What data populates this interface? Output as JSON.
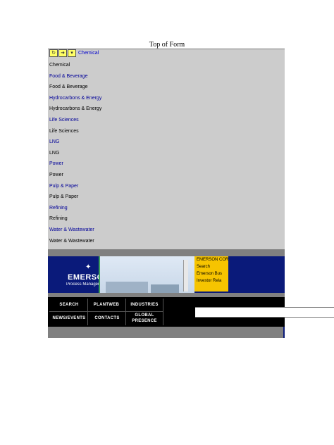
{
  "form": {
    "top_label": "Top of Form"
  },
  "industry_selector": {
    "icons": [
      "refresh-icon",
      "go-icon",
      "dropdown-icon"
    ],
    "selected": "Chemical"
  },
  "industry_list": [
    {
      "label": "Chemical",
      "kind": "text"
    },
    {
      "label": "Food & Beverage",
      "kind": "link"
    },
    {
      "label": "Food & Beverage",
      "kind": "text"
    },
    {
      "label": "Hydrocarbons & Energy",
      "kind": "link"
    },
    {
      "label": "Hydrocarbons & Energy",
      "kind": "text"
    },
    {
      "label": "Life Sciences",
      "kind": "link"
    },
    {
      "label": "Life Sciences",
      "kind": "text"
    },
    {
      "label": "LNG",
      "kind": "link"
    },
    {
      "label": "LNG",
      "kind": "text"
    },
    {
      "label": "Power",
      "kind": "link"
    },
    {
      "label": "Power",
      "kind": "text"
    },
    {
      "label": "Pulp & Paper",
      "kind": "link"
    },
    {
      "label": "Pulp & Paper",
      "kind": "text"
    },
    {
      "label": "Refining",
      "kind": "link"
    },
    {
      "label": "Refining",
      "kind": "text"
    },
    {
      "label": "Water & Wastewater",
      "kind": "link"
    },
    {
      "label": "Water & Wastewater",
      "kind": "text"
    }
  ],
  "banner": {
    "brand_name": "EMERSON",
    "brand_sub": "Process Management",
    "corp_menu": [
      "EMERSON COR",
      "Search",
      "Emerson Bus",
      "Investor Rela"
    ]
  },
  "nav": {
    "search": "Search",
    "plantweb": "PlantWeb",
    "industries": "Industries",
    "news_events": "News/Events",
    "contacts": "Contacts",
    "global_presence_1": "Global",
    "global_presence_2": "Presence"
  },
  "colors": {
    "panel": "#cccccc",
    "link": "#000099",
    "banner": "#0a1a7a",
    "menu": "#f6c400"
  }
}
